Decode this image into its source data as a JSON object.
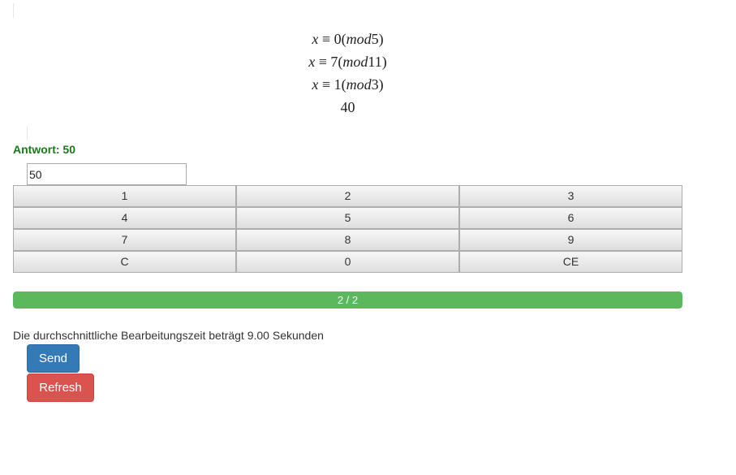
{
  "equations": [
    {
      "var": "x",
      "rel": "≡",
      "value": "0",
      "mod": "mod",
      "modulus": "5"
    },
    {
      "var": "x",
      "rel": "≡",
      "value": "7",
      "mod": "mod",
      "modulus": "11"
    },
    {
      "var": "x",
      "rel": "≡",
      "value": "1",
      "mod": "mod",
      "modulus": "3"
    }
  ],
  "result_line": "40",
  "answer_label": "Antwort: 50",
  "input": {
    "value": "50"
  },
  "keypad": {
    "rows": [
      [
        "1",
        "2",
        "3"
      ],
      [
        "4",
        "5",
        "6"
      ],
      [
        "7",
        "8",
        "9"
      ],
      [
        "C",
        "0",
        "CE"
      ]
    ]
  },
  "progress": {
    "label": "2 / 2",
    "fraction": 1.0,
    "color": "#5cb85c"
  },
  "avg_time_text": "Die durchschnittliche Bearbeitungszeit beträgt 9.00 Sekunden",
  "buttons": {
    "send": "Send",
    "refresh": "Refresh"
  },
  "colors": {
    "answer": "#1a7a1a",
    "send": "#337ab7",
    "refresh": "#d9534f"
  }
}
